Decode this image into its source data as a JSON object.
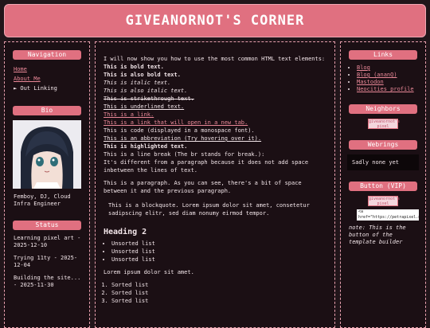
{
  "header": {
    "title": "GIVEANORNOT'S CORNER"
  },
  "navigation": {
    "title": "Navigation",
    "items": [
      {
        "label": "Home",
        "link": true
      },
      {
        "label": "About Me",
        "link": true
      },
      {
        "label": "► Out Linking",
        "link": false
      }
    ]
  },
  "bio": {
    "title": "Bio",
    "text": "Femboy, DJ, Cloud Infra Engineer"
  },
  "status": {
    "title": "Status",
    "entries": [
      "Learning pixel art - 2025-12-10",
      "Trying 11ty - 2025-12-04",
      "Building the site... - 2025-11-30"
    ]
  },
  "main": {
    "intro": "I will now show you how to use the most common HTML text elements:",
    "bold1": "This is bold text.",
    "bold2": "This is also bold text.",
    "italic1": "This is italic text.",
    "italic2": "This is also italic text.",
    "strike": "This is strikethrough text.",
    "underline": "This is underlined text.",
    "link1": "This is a link.",
    "link2": "This is a link that will open in a new tab.",
    "code": "This is code (displayed in a monospace font).",
    "abbr": "This is an abbreviation (Try hovering over it).",
    "highlight": "This is highlighted text.",
    "linebreak1": "This is a line break (The br stands for break.):",
    "linebreak2": "It's different from a paragraph because it does not add space inbetween the lines of text.",
    "paragraph": "This is a paragraph. As you can see, there's a bit of space between it and the previous paragraph.",
    "blockquote": "This is a blockquote. Lorem ipsum dolor sit amet, consetetur sadipscing elitr, sed diam nonumy eirmod tempor.",
    "heading2": "Heading 2",
    "unsorted": [
      "Unsorted list",
      "Unsorted list",
      "Unsorted list"
    ],
    "lorem": "Lorem ipsum dolor sit amet.",
    "sorted": [
      "Sorted list",
      "Sorted list",
      "Sorted list"
    ]
  },
  "links": {
    "title": "Links",
    "items": [
      "Blog",
      "Blog (ananQ)",
      "Mastodon",
      "Neocities profile"
    ]
  },
  "neighbors": {
    "title": "Neighbors",
    "badge": "giveanornot's pixel"
  },
  "webrings": {
    "title": "Webrings",
    "text": "Sadly none yet"
  },
  "vip": {
    "title": "Button (VIP)",
    "badge": "giveanornot's pixel",
    "code": "<a href=\"https://petrapixel.neocities.org\">",
    "note": "note: This is the button of the template builder"
  },
  "colors": {
    "accent": "#e07080",
    "background": "#21151a",
    "panel": "#1b0f14",
    "link": "#ea8898"
  }
}
